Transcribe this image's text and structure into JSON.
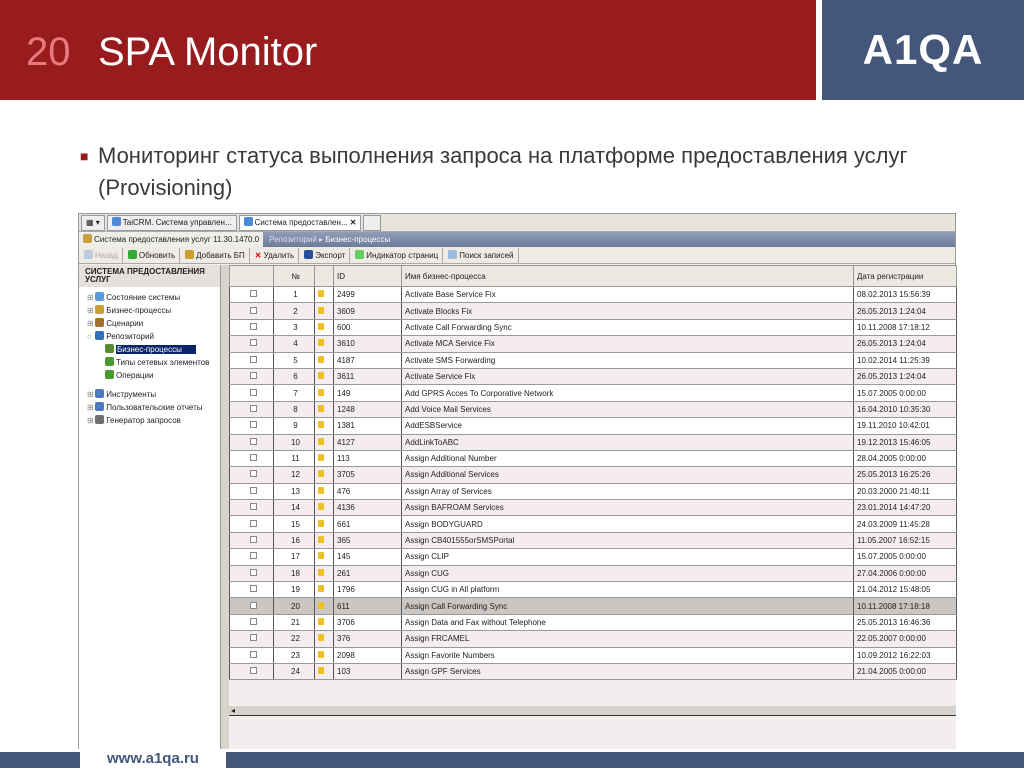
{
  "slide": {
    "number": "20",
    "title": "SPA Monitor",
    "logo": "A1QA",
    "bullet": "Мониторинг статуса выполнения запроса на платформе предоставления услуг (Provisioning)",
    "footer_url": "www.a1qa.ru",
    "colors": {
      "header": "#981b1e",
      "brand_blue": "#44577a"
    }
  },
  "app": {
    "tabs": [
      "TaiCRM. Система управлен...",
      "Система предоставлен..."
    ],
    "app_title": "Система предоставления услуг 11.30.1470.0",
    "breadcrumb": [
      "Репозиторий",
      "Бизнес-процессы"
    ],
    "toolbar": [
      "Назад",
      "Обновить",
      "Добавить БП",
      "Удалить",
      "Экспорт",
      "Индикатор страниц",
      "Поиск записей"
    ],
    "sidebar": {
      "header": "СИСТЕМА ПРЕДОСТАВЛЕНИЯ УСЛУГ",
      "items": [
        {
          "label": "Состояние системы",
          "level": 0
        },
        {
          "label": "Бизнес-процессы",
          "level": 0
        },
        {
          "label": "Сценарии",
          "level": 0
        },
        {
          "label": "Репозиторий",
          "level": 0
        },
        {
          "label": "Бизнес-процессы",
          "level": 1,
          "selected": true
        },
        {
          "label": "Типы сетевых элементов",
          "level": 1
        },
        {
          "label": "Операции",
          "level": 1
        },
        {
          "label": "Инструменты",
          "level": 0
        },
        {
          "label": "Пользовательские отчеты",
          "level": 0
        },
        {
          "label": "Генератор запросов",
          "level": 0
        }
      ]
    },
    "columns": [
      "№",
      "ID",
      "Имя бизнес-процесса",
      "Дата регистрации"
    ],
    "rows": [
      [
        "1",
        "2499",
        "Activate Base Service Fix",
        "08.02.2013 15:56:39"
      ],
      [
        "2",
        "3609",
        "Activate Blocks Fix",
        "26.05.2013 1:24:04"
      ],
      [
        "3",
        "600",
        "Activate Call Forwarding Sync",
        "10.11.2008 17:18:12"
      ],
      [
        "4",
        "3610",
        "Activate MCA Service Fix",
        "26.05.2013 1:24:04"
      ],
      [
        "5",
        "4187",
        "Activate SMS Forwarding",
        "10.02.2014 11:25:39"
      ],
      [
        "6",
        "3611",
        "Activate Service Fix",
        "26.05.2013 1:24:04"
      ],
      [
        "7",
        "149",
        "Add GPRS Acces To Corporative Network",
        "15.07.2005 0:00:00"
      ],
      [
        "8",
        "1248",
        "Add Voice Mail Services",
        "16.04.2010 10:35:30"
      ],
      [
        "9",
        "1381",
        "AddESBService",
        "19.11.2010 10:42:01"
      ],
      [
        "10",
        "4127",
        "AddLinkToABC",
        "19.12.2013 15:46:05"
      ],
      [
        "11",
        "113",
        "Assign Additional Number",
        "28.04.2005 0:00:00"
      ],
      [
        "12",
        "3705",
        "Assign Additional Services",
        "25.05.2013 16:25:26"
      ],
      [
        "13",
        "476",
        "Assign Array of Services",
        "20.03.2000 21:40:11"
      ],
      [
        "14",
        "4136",
        "Assign BAFROAM Services",
        "23.01.2014 14:47:20"
      ],
      [
        "15",
        "661",
        "Assign BODYGUARD",
        "24.03.2009 11:45:28"
      ],
      [
        "16",
        "365",
        "Assign CB401555orSMSPortal",
        "11.05.2007 16:52:15"
      ],
      [
        "17",
        "145",
        "Assign CLIP",
        "15.07.2005 0:00:00"
      ],
      [
        "18",
        "261",
        "Assign CUG",
        "27.04.2006 0:00:00"
      ],
      [
        "19",
        "1796",
        "Assign CUG in All platform",
        "21.04.2012 15:48:05"
      ],
      [
        "20",
        "611",
        "Assign Call Forwarding Sync",
        "10.11.2008 17:18:18"
      ],
      [
        "21",
        "3706",
        "Assign Data and Fax without Telephone",
        "25.05.2013 16:46:36"
      ],
      [
        "22",
        "376",
        "Assign FRCAMEL",
        "22.05.2007 0:00:00"
      ],
      [
        "23",
        "2098",
        "Assign Favorite Numbers",
        "10.09.2012 16:22:03"
      ],
      [
        "24",
        "103",
        "Assign GPF Services",
        "21.04.2005 0:00:00"
      ]
    ],
    "highlighted_row": "20"
  }
}
